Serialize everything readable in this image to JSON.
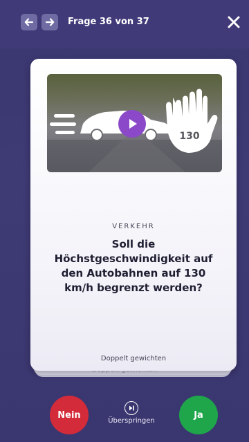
{
  "header": {
    "question_count": "Frage 36 von 37",
    "back_icon": "arrow-left-icon",
    "forward_icon": "arrow-right-icon",
    "close_icon": "close-icon"
  },
  "card": {
    "category": "VERKEHR",
    "question": "Soll die Höchstgeschwindigkeit auf den Autobahnen auf 130 km/h begrenzt werden?",
    "double_weight_label": "Doppelt gewichten",
    "media_sign_text": "130"
  },
  "actions": {
    "no_label": "Nein",
    "skip_label": "Überspringen",
    "yes_label": "Ja"
  },
  "colors": {
    "background": "#3b3770",
    "no": "#d32b3a",
    "yes": "#1fa64a",
    "play": "#8b49c9"
  }
}
